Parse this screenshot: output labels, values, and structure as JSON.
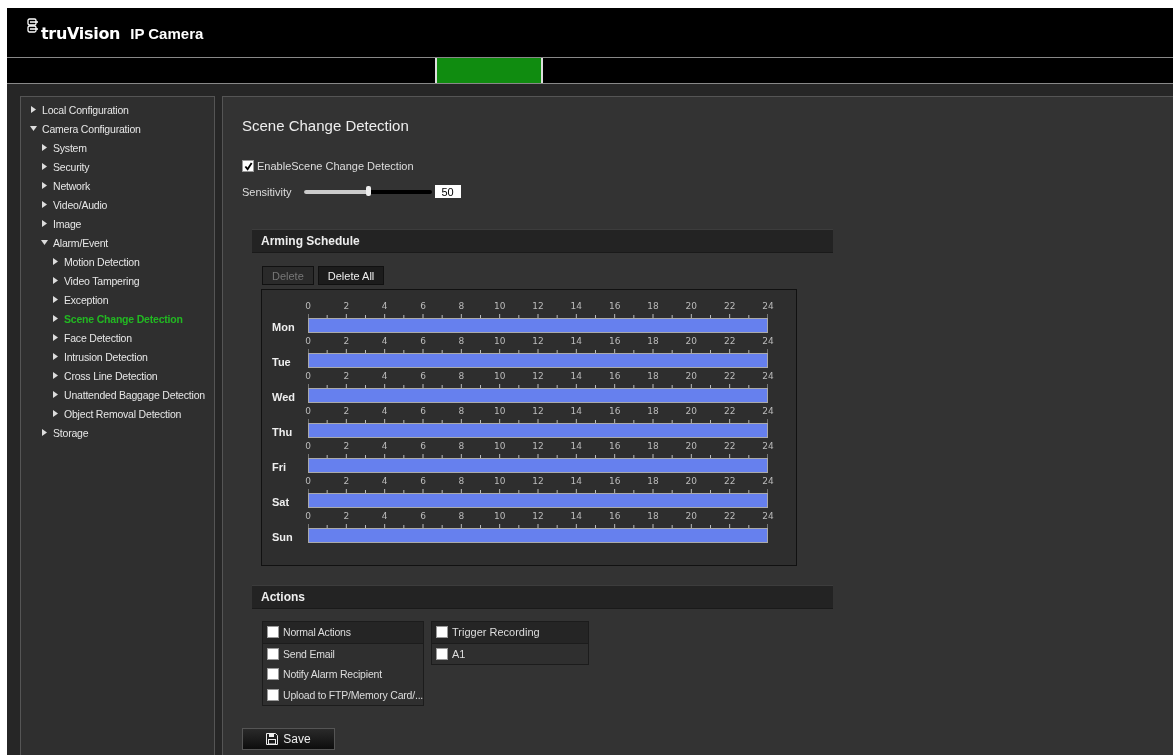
{
  "header": {
    "brand": "truVision",
    "product": "IP Camera"
  },
  "nav": {
    "tabs": [
      {
        "selected": true
      }
    ]
  },
  "sidebar": {
    "items": [
      {
        "label": "Local Configuration",
        "expanded": false,
        "selected": false
      },
      {
        "label": "Camera Configuration",
        "expanded": true,
        "selected": false,
        "children": [
          {
            "label": "System",
            "expanded": false,
            "selected": false
          },
          {
            "label": "Security",
            "expanded": false,
            "selected": false
          },
          {
            "label": "Network",
            "expanded": false,
            "selected": false
          },
          {
            "label": "Video/Audio",
            "expanded": false,
            "selected": false
          },
          {
            "label": "Image",
            "expanded": false,
            "selected": false
          },
          {
            "label": "Alarm/Event",
            "expanded": true,
            "selected": false,
            "children": [
              {
                "label": "Motion Detection",
                "expanded": false,
                "selected": false
              },
              {
                "label": "Video Tampering",
                "expanded": false,
                "selected": false
              },
              {
                "label": "Exception",
                "expanded": false,
                "selected": false
              },
              {
                "label": "Scene Change Detection",
                "expanded": false,
                "selected": true
              },
              {
                "label": "Face Detection",
                "expanded": false,
                "selected": false
              },
              {
                "label": "Intrusion Detection",
                "expanded": false,
                "selected": false
              },
              {
                "label": "Cross Line Detection",
                "expanded": false,
                "selected": false
              },
              {
                "label": "Unattended Baggage Detection",
                "expanded": false,
                "selected": false
              },
              {
                "label": "Object Removal Detection",
                "expanded": false,
                "selected": false
              }
            ]
          },
          {
            "label": "Storage",
            "expanded": false,
            "selected": false
          }
        ]
      }
    ]
  },
  "page": {
    "title": "Scene Change Detection",
    "enable": {
      "label": "EnableScene Change Detection",
      "checked": true
    },
    "sensitivity": {
      "label": "Sensitivity",
      "level": 0.5,
      "value": "50"
    }
  },
  "arming_schedule": {
    "title": "Arming Schedule",
    "buttons": [
      {
        "label": "Delete",
        "disabled": true
      },
      {
        "label": "Delete All",
        "disabled": false
      }
    ],
    "days": [
      {
        "name": "Mon",
        "ticks": [
          "0",
          "2",
          "4",
          "6",
          "8",
          "10",
          "12",
          "14",
          "16",
          "18",
          "20",
          "22",
          "24"
        ]
      },
      {
        "name": "Tue",
        "ticks": [
          "0",
          "2",
          "4",
          "6",
          "8",
          "10",
          "12",
          "14",
          "16",
          "18",
          "20",
          "22",
          "24"
        ]
      },
      {
        "name": "Wed",
        "ticks": [
          "0",
          "2",
          "4",
          "6",
          "8",
          "10",
          "12",
          "14",
          "16",
          "18",
          "20",
          "22",
          "24"
        ]
      },
      {
        "name": "Thu",
        "ticks": [
          "0",
          "2",
          "4",
          "6",
          "8",
          "10",
          "12",
          "14",
          "16",
          "18",
          "20",
          "22",
          "24"
        ]
      },
      {
        "name": "Fri",
        "ticks": [
          "0",
          "2",
          "4",
          "6",
          "8",
          "10",
          "12",
          "14",
          "16",
          "18",
          "20",
          "22",
          "24"
        ]
      },
      {
        "name": "Sat",
        "ticks": [
          "0",
          "2",
          "4",
          "6",
          "8",
          "10",
          "12",
          "14",
          "16",
          "18",
          "20",
          "22",
          "24"
        ]
      },
      {
        "name": "Sun",
        "ticks": [
          "0",
          "2",
          "4",
          "6",
          "8",
          "10",
          "12",
          "14",
          "16",
          "18",
          "20",
          "22",
          "24"
        ]
      }
    ]
  },
  "actions": {
    "title": "Actions",
    "groups": [
      {
        "items": [
          {
            "label": "Normal Actions",
            "kind": "header",
            "checked": false
          },
          {
            "label": "Send Email",
            "kind": "option",
            "checked": false
          },
          {
            "label": "Notify Alarm Recipient",
            "kind": "option",
            "checked": false
          },
          {
            "label": "Upload to FTP/Memory Card/...",
            "kind": "option",
            "checked": false
          }
        ]
      },
      {
        "items": [
          {
            "label": "Trigger Recording",
            "kind": "header",
            "checked": false
          },
          {
            "label": "A1",
            "kind": "option",
            "checked": false
          }
        ]
      }
    ]
  },
  "save_button": {
    "label": "Save"
  }
}
